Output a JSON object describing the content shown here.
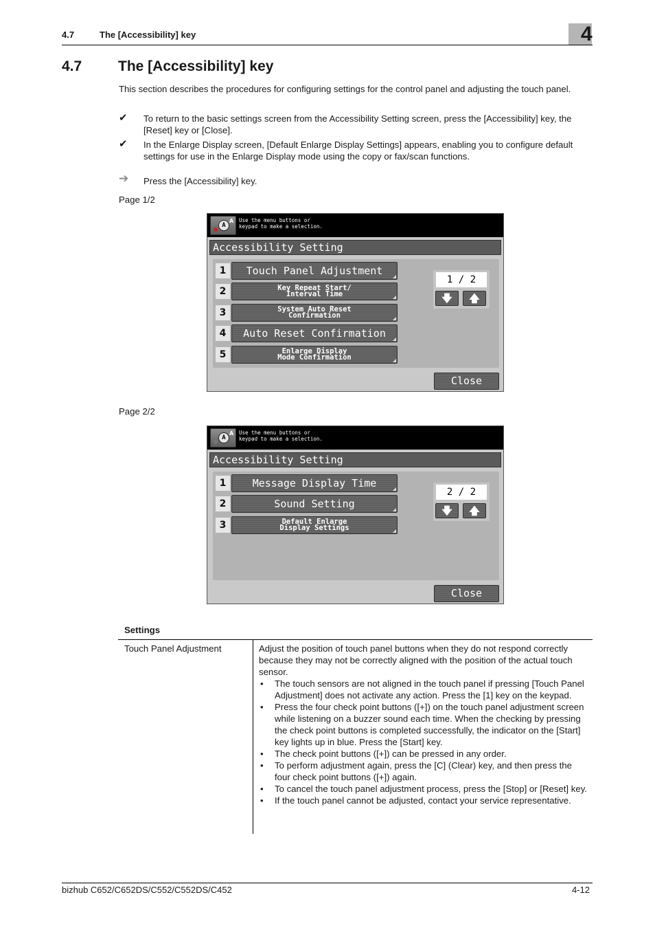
{
  "header": {
    "section_number": "4.7",
    "section_title": "The [Accessibility] key",
    "chapter_number": "4"
  },
  "section": {
    "number": "4.7",
    "title": "The [Accessibility] key",
    "intro": "This section describes the procedures for configuring settings for the control panel and adjusting the touch panel.",
    "notes": [
      {
        "icon": "✔",
        "text": "To return to the basic settings screen from the Accessibility Setting screen, press the [Accessibility] key, the [Reset] key or [Close]."
      },
      {
        "icon": "✔",
        "text": "In the Enlarge Display screen, [Default Enlarge Display Settings] appears, enabling you to configure default settings for use in the Enlarge Display mode using the copy or fax/scan functions."
      }
    ],
    "step_icon": "➔",
    "step": "Press the [Accessibility] key."
  },
  "screens": [
    {
      "label": "Page 1/2",
      "message_line1": "Use the menu buttons or",
      "message_line2": "keypad to make a selection.",
      "title": "Accessibility Setting",
      "page_indicator": "1 / 2",
      "down_icon": "🡇",
      "up_icon": "🡅",
      "close_label": "Close",
      "items": [
        {
          "num": "1",
          "label": "Touch Panel Adjustment",
          "size": "big"
        },
        {
          "num": "2",
          "label": "Key Repeat Start/\nInterval Time",
          "size": "small"
        },
        {
          "num": "3",
          "label": "System Auto Reset\nConfirmation",
          "size": "small"
        },
        {
          "num": "4",
          "label": "Auto Reset Confirmation",
          "size": "big"
        },
        {
          "num": "5",
          "label": "Enlarge Display\nMode Confirmation",
          "size": "small"
        }
      ]
    },
    {
      "label": "Page 2/2",
      "message_line1": "Use the menu buttons or",
      "message_line2": "keypad to make a selection.",
      "title": "Accessibility Setting",
      "page_indicator": "2 / 2",
      "down_icon": "🡇",
      "up_icon": "🡅",
      "close_label": "Close",
      "items": [
        {
          "num": "1",
          "label": "Message Display Time",
          "size": "big"
        },
        {
          "num": "2",
          "label": "Sound Setting",
          "size": "big"
        },
        {
          "num": "3",
          "label": "Default Enlarge\nDisplay Settings",
          "size": "small"
        }
      ]
    }
  ],
  "settings": {
    "heading": "Settings",
    "rows": [
      {
        "name": "Touch Panel Adjustment",
        "description": "Adjust the position of touch panel buttons when they do not respond correctly because they may not be correctly aligned with the position of the actual touch sensor.",
        "bullets": [
          "The touch sensors are not aligned in the touch panel if pressing [Touch Panel Adjustment] does not activate any action. Press the [1] key on the keypad.",
          "Press the four check point buttons ([+]) on the touch panel adjustment screen while listening on a buzzer sound each time. When the checking by pressing the check point buttons is completed successfully, the indicator on the [Start] key lights up in blue. Press the [Start] key.",
          "The check point buttons ([+]) can be pressed in any order.",
          "To perform adjustment again, press the [C] (Clear) key, and then press the four check point buttons ([+]) again.",
          "To cancel the touch panel adjustment process, press the [Stop] or [Reset] key.",
          "If the touch panel cannot be adjusted, contact your service representative."
        ]
      }
    ]
  },
  "footer": {
    "model": "bizhub C652/C652DS/C552/C552DS/C452",
    "page": "4-12"
  }
}
